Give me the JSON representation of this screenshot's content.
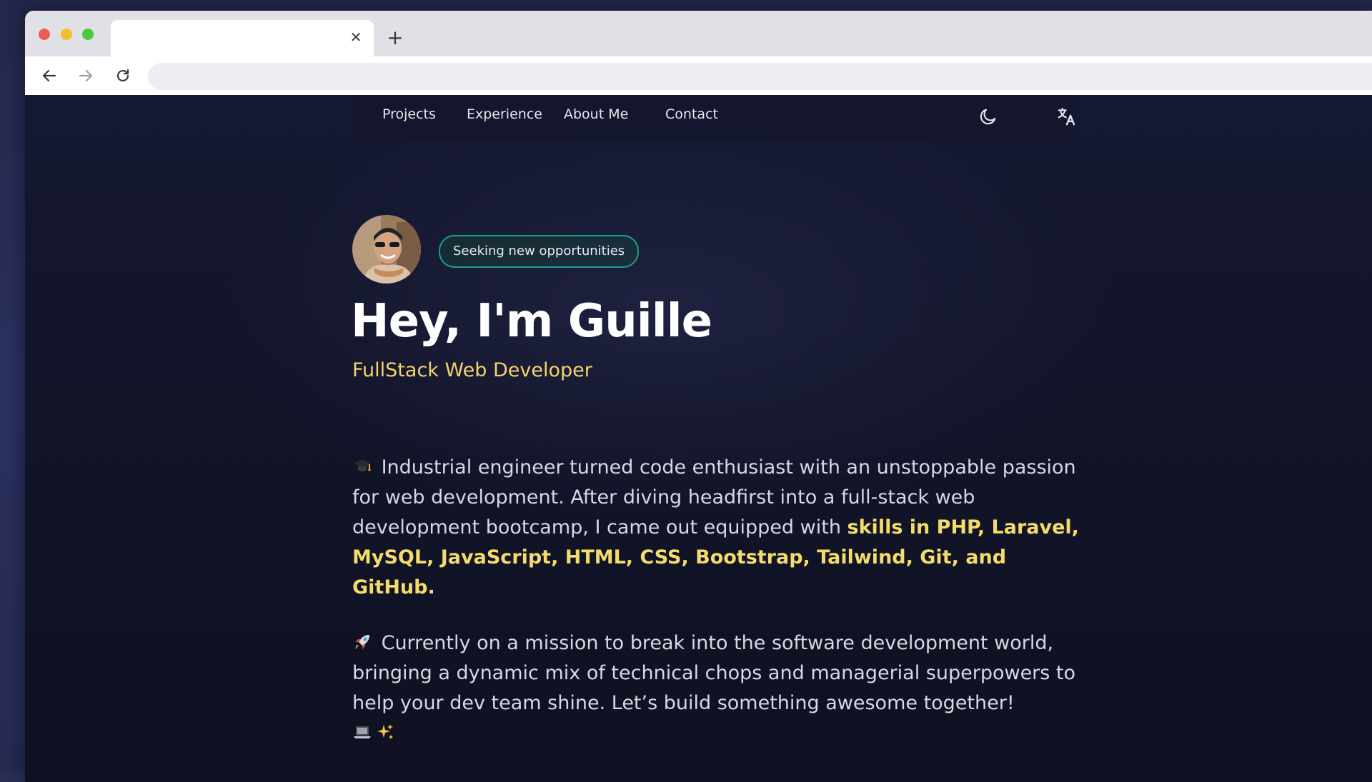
{
  "browser": {
    "tab": {
      "title": "",
      "close_glyph": "✕"
    },
    "new_tab_glyph": "+",
    "address": {
      "value": ""
    },
    "controls": {
      "back_icon": "arrow-left-icon",
      "forward_icon": "arrow-right-icon",
      "reload_icon": "reload-icon"
    }
  },
  "nav": {
    "links": [
      "Projects",
      "Experience",
      "About Me",
      "Contact"
    ],
    "theme_toggle_icon": "moon-icon",
    "language_icon": "translate-icon"
  },
  "hero": {
    "badge": "Seeking new opportunities",
    "title": "Hey, I'm Guille",
    "subtitle": "FullStack Web Developer"
  },
  "about": {
    "p1_emoji": "graduation-cap-icon",
    "p1_text": "Industrial engineer turned code enthusiast with an unstoppable passion for web development. After diving headfirst into a full-stack web development bootcamp, I came out equipped with ",
    "p1_highlight": "skills in PHP, Laravel, MySQL, JavaScript, HTML, CSS, Bootstrap, Tailwind, Git, and GitHub.",
    "p2_emoji": "rocket-icon",
    "p2_text": "Currently on a mission to break into the software development world, bringing a dynamic mix of technical chops and managerial superpowers to help your dev team shine. Let’s build something awesome together!",
    "p2_trailing_emojis": "laptop-icon sparkles-icon"
  },
  "colors": {
    "accent": "#f3d36b",
    "badge_border": "#1f9f86",
    "background": "#121429"
  }
}
